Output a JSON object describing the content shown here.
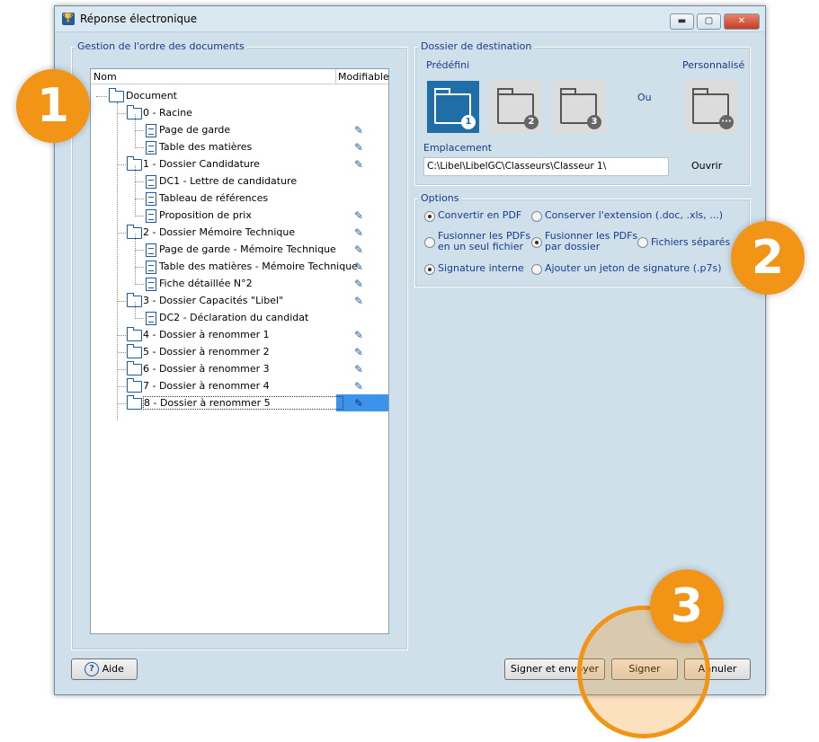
{
  "window": {
    "title": "Réponse électronique",
    "controls": {
      "minimize": "▬",
      "maximize": "▢",
      "close": "✕"
    }
  },
  "left_panel": {
    "group_label": "Gestion de l'ordre des documents",
    "columns": {
      "name": "Nom",
      "modifiable": "Modifiable"
    },
    "root": "Document",
    "rows": [
      {
        "label": "0 - Racine",
        "type": "folder",
        "level": 1,
        "editable": false
      },
      {
        "label": "Page de garde",
        "type": "doc",
        "level": 2,
        "editable": true
      },
      {
        "label": "Table des matières",
        "type": "doc",
        "level": 2,
        "editable": true
      },
      {
        "label": "1 - Dossier Candidature",
        "type": "folder",
        "level": 1,
        "editable": true
      },
      {
        "label": "DC1 - Lettre de candidature",
        "type": "doc",
        "level": 2,
        "editable": false
      },
      {
        "label": "Tableau de références",
        "type": "doc",
        "level": 2,
        "editable": false
      },
      {
        "label": "Proposition de prix",
        "type": "doc",
        "level": 2,
        "editable": true
      },
      {
        "label": "2 - Dossier Mémoire Technique",
        "type": "folder",
        "level": 1,
        "editable": true
      },
      {
        "label": "Page de garde - Mémoire Technique",
        "type": "doc",
        "level": 2,
        "editable": true
      },
      {
        "label": "Table des matières - Mémoire Technique",
        "type": "doc",
        "level": 2,
        "editable": true
      },
      {
        "label": "Fiche détaillée N°2",
        "type": "doc",
        "level": 2,
        "editable": true
      },
      {
        "label": "3 - Dossier Capacités \"Libel\"",
        "type": "folder",
        "level": 1,
        "editable": true
      },
      {
        "label": "DC2 - Déclaration du candidat",
        "type": "doc",
        "level": 2,
        "editable": false
      },
      {
        "label": "4 - Dossier à renommer 1",
        "type": "folder",
        "level": 1,
        "editable": true
      },
      {
        "label": "5 - Dossier à renommer 2",
        "type": "folder",
        "level": 1,
        "editable": true
      },
      {
        "label": "6 - Dossier à renommer 3",
        "type": "folder",
        "level": 1,
        "editable": true
      },
      {
        "label": "7 - Dossier à renommer 4",
        "type": "folder",
        "level": 1,
        "editable": true
      },
      {
        "label": "8 - Dossier à renommer 5",
        "type": "folder",
        "level": 1,
        "editable": true,
        "selected": true
      }
    ],
    "icons": {
      "edit": "pencil-icon",
      "folder": "folder-icon",
      "document": "document-icon"
    }
  },
  "destination": {
    "group_label": "Dossier de destination",
    "predefined_label": "Prédéfini",
    "custom_label": "Personnalisé",
    "or_label": "Ou",
    "folders": [
      {
        "badge": "1",
        "selected": true
      },
      {
        "badge": "2"
      },
      {
        "badge": "3"
      }
    ],
    "custom_badge": "···",
    "location_label": "Emplacement",
    "location_value": "C:\\Libel\\LibelGC\\Classeurs\\Classeur 1\\",
    "open_label": "Ouvrir"
  },
  "options": {
    "group_label": "Options",
    "convert_pdf": "Convertir en PDF",
    "keep_extension": "Conserver l'extension (.doc, .xls, ...)",
    "merge_single_1": "Fusionner les PDFs",
    "merge_single_2": "en un seul fichier",
    "merge_folder_1": "Fusionner les PDFs",
    "merge_folder_2": "par dossier",
    "separate_files": "Fichiers séparés",
    "internal_sig": "Signature interne",
    "add_token": "Ajouter un jeton de signature (.p7s)"
  },
  "footer": {
    "help": "Aide",
    "help_icon": "?",
    "sign_send": "Signer et envoyer",
    "sign": "Signer",
    "cancel": "Annuler"
  },
  "callouts": [
    "1",
    "2",
    "3"
  ],
  "colors": {
    "accent": "#f29416",
    "selection": "#3d92ea",
    "folder_selected": "#1f6ea8",
    "label_blue": "#1a3b8c"
  }
}
